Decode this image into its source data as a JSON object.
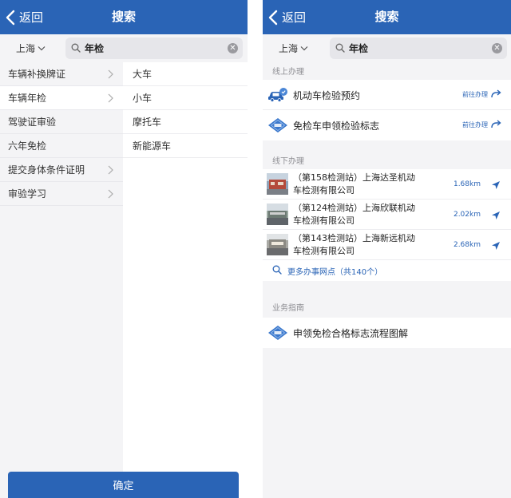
{
  "left": {
    "nav": {
      "back_label": "返回",
      "title": "搜索"
    },
    "search": {
      "city": "上海",
      "query": "年检"
    },
    "categories": [
      {
        "label": "车辆补换牌证",
        "has_children": true
      },
      {
        "label": "车辆年检",
        "has_children": true
      },
      {
        "label": "驾驶证审验",
        "has_children": false
      },
      {
        "label": "六年免检",
        "has_children": false
      },
      {
        "label": "提交身体条件证明",
        "has_children": true
      },
      {
        "label": "审验学习",
        "has_children": true
      }
    ],
    "subitems": [
      "大车",
      "小车",
      "摩托车",
      "新能源车"
    ],
    "confirm_label": "确定"
  },
  "right": {
    "nav": {
      "back_label": "返回",
      "title": "搜索"
    },
    "search": {
      "city": "上海",
      "query": "年检"
    },
    "online": {
      "header": "线上办理",
      "items": [
        {
          "label": "机动车检验预约",
          "action": "前往办理",
          "icon": "car-badge-icon"
        },
        {
          "label": "免检车申领检验标志",
          "action": "前往办理",
          "icon": "exempt-badge-icon"
        }
      ]
    },
    "offline": {
      "header": "线下办理",
      "stations": [
        {
          "line1": "（第158检测站）上海达圣机动",
          "line2": "车检测有限公司",
          "distance": "1.68km"
        },
        {
          "line1": "（第124检测站）上海欣联机动",
          "line2": "车检测有限公司",
          "distance": "2.02km"
        },
        {
          "line1": "（第143检测站）上海新远机动",
          "line2": "车检测有限公司",
          "distance": "2.68km"
        }
      ],
      "more_label": "更多办事网点（共140个）"
    },
    "guide": {
      "header": "业务指南",
      "items": [
        {
          "label": "申领免检合格标志流程图解",
          "icon": "exempt-badge-icon"
        }
      ]
    }
  },
  "colors": {
    "brand": "#2a64b6",
    "background": "#f4f4f6",
    "secondary_text": "#8d8d92"
  },
  "icons": [
    "back-chevron-icon",
    "dropdown-chevron-icon",
    "search-icon",
    "clear-icon",
    "chevron-right-icon",
    "share-arrow-icon",
    "navigate-icon",
    "car-badge-icon",
    "exempt-badge-icon"
  ]
}
